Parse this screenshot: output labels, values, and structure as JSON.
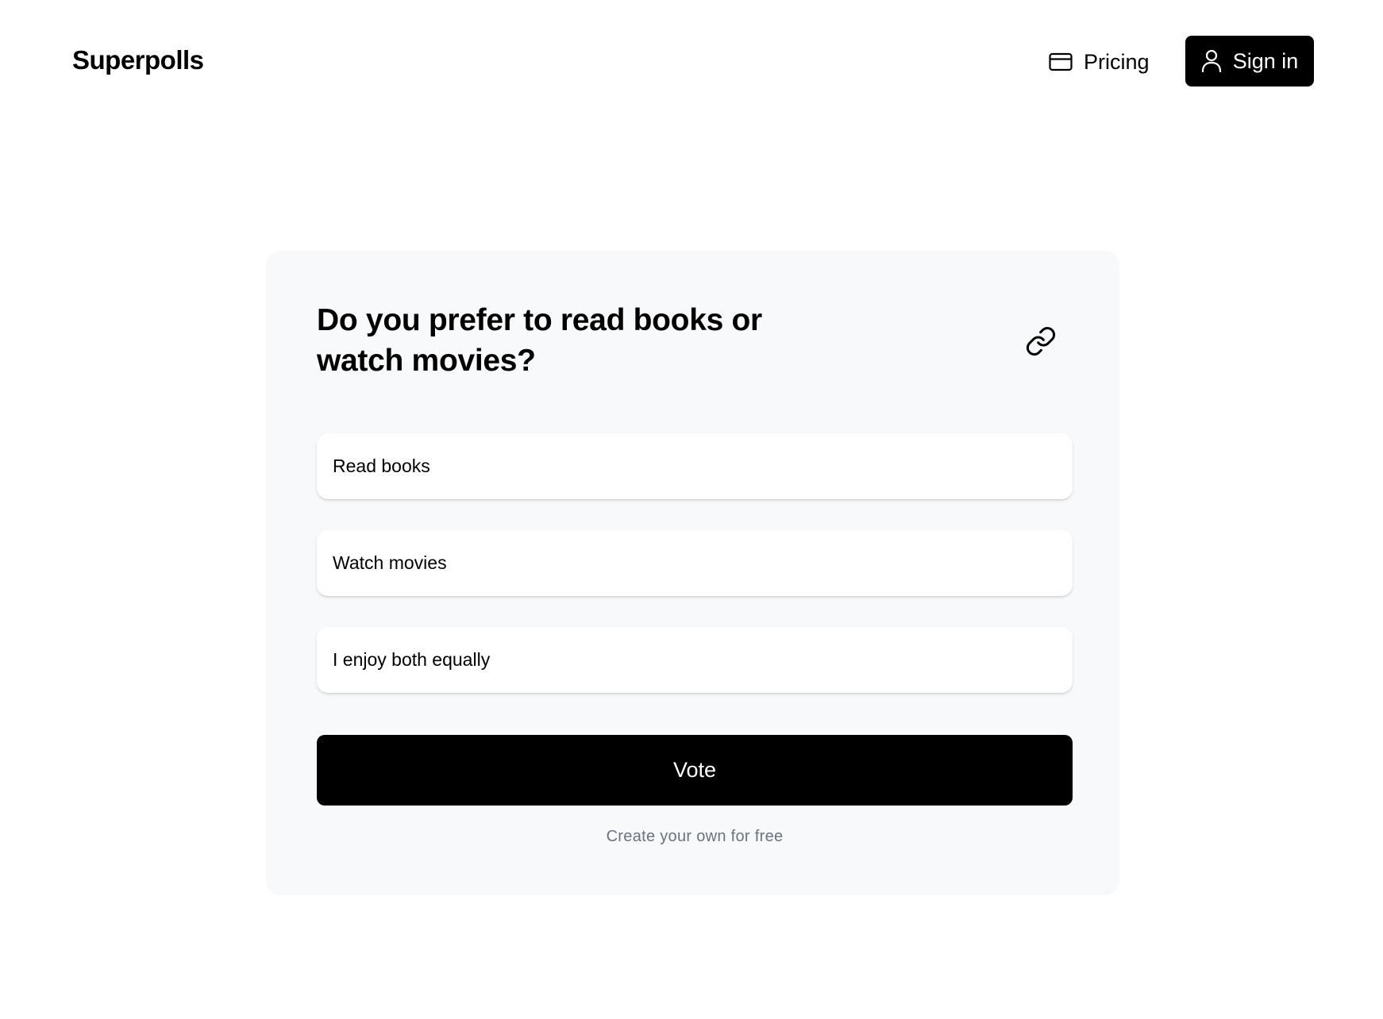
{
  "header": {
    "brand": "Superpolls",
    "pricing_label": "Pricing",
    "pricing_icon": "credit-card-icon",
    "signin_label": "Sign in",
    "signin_icon": "user-icon"
  },
  "poll": {
    "question": "Do you prefer to read books or watch movies?",
    "share_icon": "link-icon",
    "options": [
      {
        "label": "Read books"
      },
      {
        "label": "Watch movies"
      },
      {
        "label": "I enjoy both equally"
      }
    ],
    "vote_label": "Vote",
    "create_link": "Create your own for free"
  },
  "colors": {
    "primary": "#000000",
    "card_background": "#f8f9fa",
    "muted_text": "#6b7280"
  }
}
